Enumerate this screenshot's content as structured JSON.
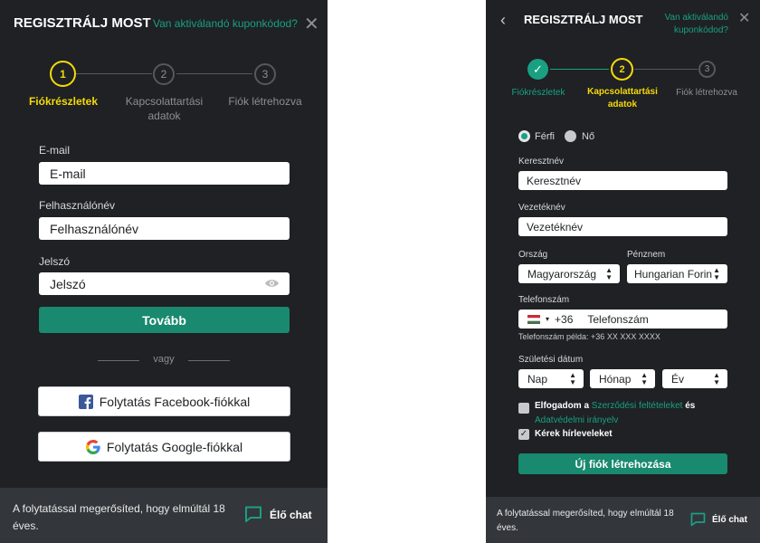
{
  "left": {
    "header": {
      "title": "REGISZTRÁLJ MOST",
      "coupon_link": "Van aktiválandó kuponkódod?"
    },
    "steps": [
      {
        "number": "1",
        "label": "Fiókrészletek",
        "state": "active"
      },
      {
        "number": "2",
        "label": "Kapcsolattartási adatok",
        "state": "pending"
      },
      {
        "number": "3",
        "label": "Fiók létrehozva",
        "state": "pending"
      }
    ],
    "form": {
      "email_label": "E-mail",
      "email_placeholder": "E-mail",
      "username_label": "Felhasználónév",
      "username_placeholder": "Felhasználónév",
      "password_label": "Jelszó",
      "password_placeholder": "Jelszó",
      "next_button": "Tovább",
      "or_text": "vagy",
      "facebook_button": "Folytatás Facebook-fiókkal",
      "google_button": "Folytatás Google-fiókkal"
    },
    "footer": {
      "text": "A folytatással megerősíted, hogy elmúltál 18 éves.",
      "chat": "Élő chat"
    }
  },
  "right": {
    "header": {
      "title": "REGISZTRÁLJ MOST",
      "coupon_link_line1": "Van aktiválandó",
      "coupon_link_line2": "kuponkódod?"
    },
    "steps": [
      {
        "number": "✓",
        "label": "Fiókrészletek",
        "state": "done"
      },
      {
        "number": "2",
        "label": "Kapcsolattartási adatok",
        "state": "active"
      },
      {
        "number": "3",
        "label": "Fiók létrehozva",
        "state": "pending"
      }
    ],
    "form": {
      "gender_male": "Férfi",
      "gender_female": "Nő",
      "gender_selected": "Férfi",
      "firstname_label": "Keresztnév",
      "firstname_placeholder": "Keresztnév",
      "lastname_label": "Vezetéknév",
      "lastname_placeholder": "Vezetéknév",
      "country_label": "Ország",
      "country_value": "Magyarország",
      "currency_label": "Pénznem",
      "currency_value": "Hungarian Forin",
      "phone_label": "Telefonszám",
      "phone_prefix": "+36",
      "phone_placeholder": "Telefonszám",
      "phone_example": "Telefonszám példa: +36 XX XXX XXXX",
      "birthdate_label": "Születési dátum",
      "day_placeholder": "Nap",
      "month_placeholder": "Hónap",
      "year_placeholder": "Év",
      "terms_prefix": "Elfogadom a",
      "terms_link": "Szerződési feltételeket",
      "terms_and": "és",
      "privacy_link": "Adatvédelmi irányelv",
      "newsletter": "Kérek hírleveleket",
      "create_button": "Új fiók létrehozása"
    },
    "footer": {
      "text": "A folytatással megerősíted, hogy elmúltál 18 éves.",
      "chat": "Élő chat"
    }
  },
  "colors": {
    "panel_bg": "#1f2124",
    "accent": "#19a083",
    "button": "#19896f",
    "active_step": "#f5d90a",
    "footer_bg": "#33373b"
  }
}
